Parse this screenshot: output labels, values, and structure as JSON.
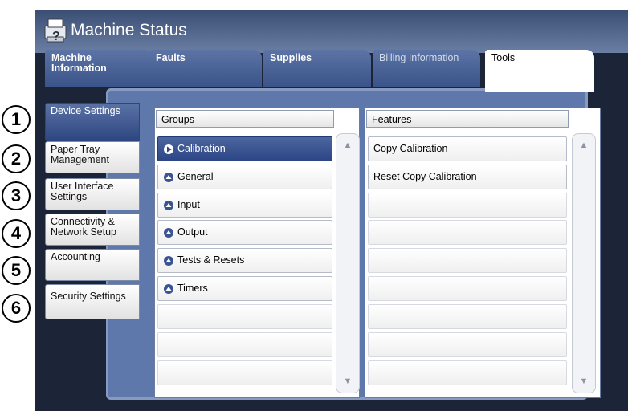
{
  "header": {
    "title": "Machine Status"
  },
  "tabs": [
    {
      "label": "Machine Information"
    },
    {
      "label": "Faults"
    },
    {
      "label": "Supplies"
    },
    {
      "label": "Billing Information"
    },
    {
      "label": "Tools"
    }
  ],
  "sidebar": {
    "items": [
      {
        "number": "1",
        "label": "Device Settings"
      },
      {
        "number": "2",
        "label": "Paper Tray Management"
      },
      {
        "number": "3",
        "label": "User Interface Settings"
      },
      {
        "number": "4",
        "label": "Connectivity & Network Setup"
      },
      {
        "number": "5",
        "label": "Accounting"
      },
      {
        "number": "6",
        "label": "Security Settings"
      }
    ]
  },
  "groups": {
    "header": "Groups",
    "items": [
      {
        "label": "Calibration",
        "selected": true
      },
      {
        "label": "General"
      },
      {
        "label": "Input"
      },
      {
        "label": "Output"
      },
      {
        "label": "Tests & Resets"
      },
      {
        "label": "Timers"
      }
    ]
  },
  "features": {
    "header": "Features",
    "items": [
      {
        "label": "Copy Calibration"
      },
      {
        "label": "Reset Copy Calibration"
      }
    ]
  },
  "colors": {
    "frame": "#1c2437",
    "panel": "#5f78ab",
    "selected": "#3a5491",
    "tab": "#4a6397"
  },
  "icons": {
    "header": "printer-question-icon",
    "group_selected": "play-circle-icon",
    "group": "up-circle-icon",
    "scroll_up": "triangle-up-icon",
    "scroll_down": "triangle-down-icon"
  }
}
